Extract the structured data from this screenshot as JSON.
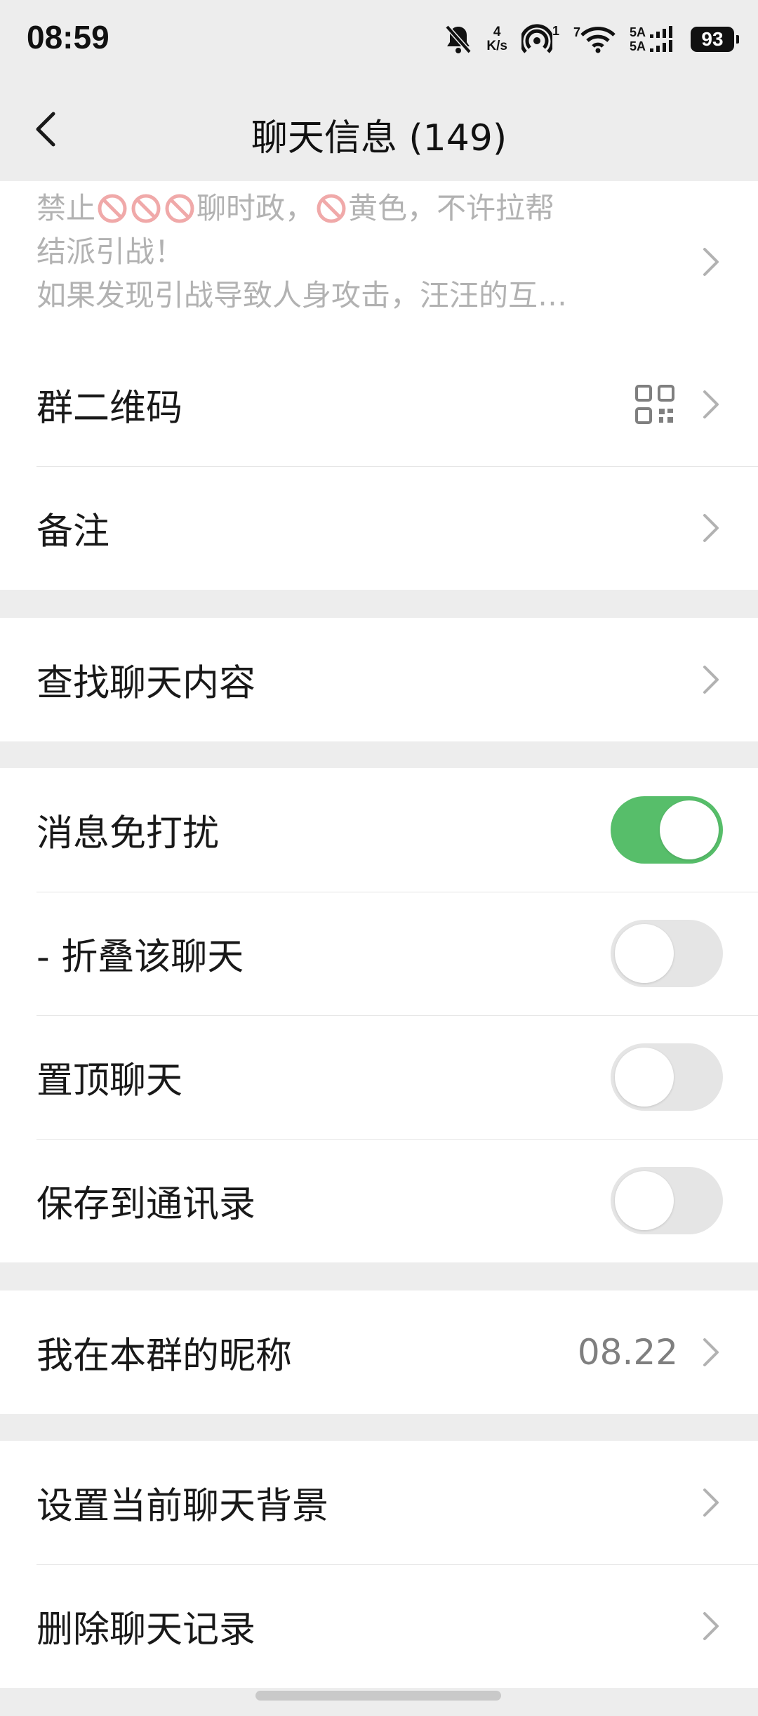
{
  "status_bar": {
    "time": "08:59",
    "net_speed_value": "4",
    "net_speed_unit": "K/s",
    "hotspot_badge": "1",
    "wifi_badge": "7",
    "sig1_label": "5A",
    "sig2_label": "5A",
    "battery": "93"
  },
  "nav": {
    "title": "聊天信息 (149)"
  },
  "announcement": {
    "line1_a": "禁止",
    "line1_b": "聊时政，",
    "line1_c": "黄色，不许拉帮",
    "line2": "结派引战！",
    "line3": "如果发现引战导致人身攻击，汪汪的互…"
  },
  "rows": {
    "qr_code": "群二维码",
    "remark": "备注",
    "search_chat": "查找聊天内容",
    "mute": "消息免打扰",
    "fold": "- 折叠该聊天",
    "pin": "置顶聊天",
    "save_contacts": "保存到通讯录",
    "nickname": "我在本群的昵称",
    "nickname_value": "08.22",
    "set_background": "设置当前聊天背景",
    "delete_history": "删除聊天记录"
  },
  "toggles": {
    "mute": true,
    "fold": false,
    "pin": false,
    "save_contacts": false
  },
  "colors": {
    "toggle_on": "#57be6a",
    "toggle_off": "#e5e5e5",
    "background": "#ededed"
  }
}
